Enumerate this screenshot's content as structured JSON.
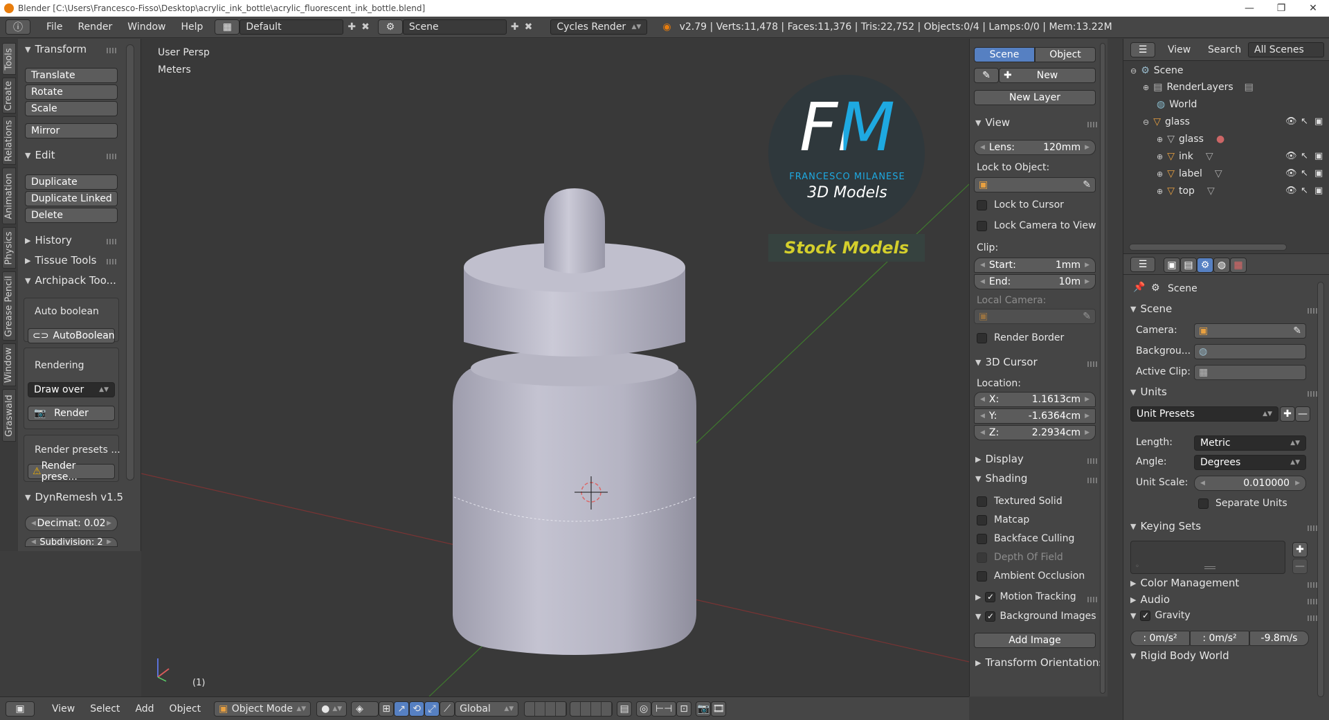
{
  "window": {
    "title": "Blender [C:\\Users\\Francesco-Fisso\\Desktop\\acrylic_ink_bottle\\acrylic_fluorescent_ink_bottle.blend]",
    "controls": [
      "—",
      "❐",
      "✕"
    ]
  },
  "infobar": {
    "menus": [
      "File",
      "Render",
      "Window",
      "Help"
    ],
    "layout": "Default",
    "scene": "Scene",
    "engine": "Cycles Render",
    "stats": "v2.79 | Verts:11,478 | Faces:11,376 | Tris:22,752 | Objects:0/4 | Lamps:0/0 | Mem:13.22M"
  },
  "tabs": [
    "Tools",
    "Create",
    "Relations",
    "Animation",
    "Physics",
    "Grease Pencil",
    "Window",
    "Graswald"
  ],
  "toolshelf": {
    "transform": {
      "title": "Transform",
      "buttons": [
        "Translate",
        "Rotate",
        "Scale",
        "Mirror"
      ]
    },
    "edit": {
      "title": "Edit",
      "buttons": [
        "Duplicate",
        "Duplicate Linked",
        "Delete"
      ]
    },
    "history": "History",
    "tissue": "Tissue Tools",
    "archipack": "Archipack Too...",
    "auto_boolean_label": "Auto boolean",
    "auto_boolean_btn": "AutoBoolean",
    "rendering_label": "Rendering",
    "draw_over": "Draw over",
    "render_btn": "Render",
    "render_presets_1": "Render presets ...",
    "render_presets_2": "Render prese...",
    "dynremesh": "DynRemesh v1.5",
    "decimate": "Decimat: 0.02",
    "subdivision": "Subdivision: 2"
  },
  "viewport": {
    "view_name": "User Persp",
    "units": "Meters",
    "frame": "(1)",
    "watermark_title": "FM",
    "watermark_name": "FRANCESCO MILANESE",
    "watermark_sub": "3D Models",
    "watermark_stock": "Stock Models"
  },
  "npanel": {
    "tabs": [
      "Scene",
      "Object"
    ],
    "new": "New",
    "new_layer": "New Layer",
    "view_title": "View",
    "lens_label": "Lens:",
    "lens_value": "120mm",
    "lock_to_object": "Lock to Object:",
    "lock_to_cursor": "Lock to Cursor",
    "lock_camera": "Lock Camera to View",
    "clip": "Clip:",
    "clip_start_label": "Start:",
    "clip_start": "1mm",
    "clip_end_label": "End:",
    "clip_end": "10m",
    "local_camera": "Local Camera:",
    "render_border": "Render Border",
    "cursor_title": "3D Cursor",
    "location": "Location:",
    "x_label": "X:",
    "x": "1.1613cm",
    "y_label": "Y:",
    "y": "-1.6364cm",
    "z_label": "Z:",
    "z": "2.2934cm",
    "display": "Display",
    "shading": "Shading",
    "shading_opts": [
      "Textured Solid",
      "Matcap",
      "Backface Culling",
      "Depth Of Field",
      "Ambient Occlusion"
    ],
    "motion_tracking": "Motion Tracking",
    "background_images": "Background Images",
    "add_image": "Add Image",
    "transform_orient": "Transform Orientations"
  },
  "outliner": {
    "menus": [
      "View",
      "Search"
    ],
    "filter": "All Scenes",
    "items": [
      {
        "label": "Scene"
      },
      {
        "label": "RenderLayers"
      },
      {
        "label": "World"
      },
      {
        "label": "glass"
      },
      {
        "label": "glass"
      },
      {
        "label": "ink"
      },
      {
        "label": "label"
      },
      {
        "label": "top"
      }
    ]
  },
  "props": {
    "context": "Scene",
    "scene_title": "Scene",
    "camera": "Camera:",
    "background": "Backgrou...",
    "active_clip": "Active Clip:",
    "units_title": "Units",
    "unit_presets": "Unit Presets",
    "length_label": "Length:",
    "length": "Metric",
    "angle_label": "Angle:",
    "angle": "Degrees",
    "scale_label": "Unit Scale:",
    "scale": "0.010000",
    "separate": "Separate Units",
    "keying": "Keying Sets",
    "color_mgmt": "Color Management",
    "audio": "Audio",
    "gravity": "Gravity",
    "g1": ": 0m/s²",
    "g2": ": 0m/s²",
    "g3": "-9.8m/s",
    "rigid": "Rigid Body World"
  },
  "bottombar": {
    "menus": [
      "View",
      "Select",
      "Add",
      "Object"
    ],
    "mode": "Object Mode",
    "orientation": "Global"
  },
  "colors": {
    "accent_blue": "#5680c2",
    "bottle": "#b9b8c6",
    "watermark_blue": "#1ea9e1",
    "watermark_yellow": "#d4cf2c"
  }
}
